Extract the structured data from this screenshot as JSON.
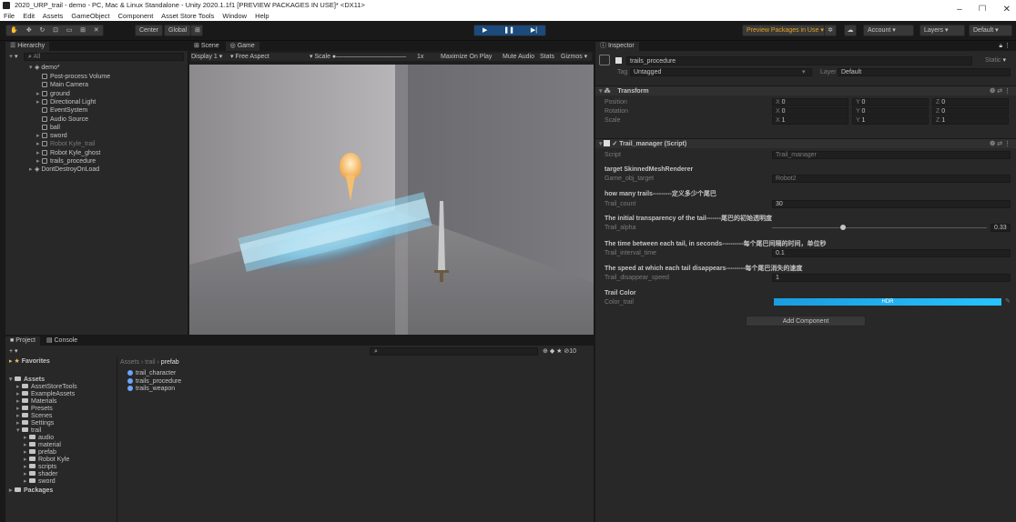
{
  "window": {
    "title": "2020_URP_trail - demo - PC, Mac & Linux Standalone - Unity 2020.1.1f1 [PREVIEW PACKAGES IN USE]* <DX11>",
    "controls": [
      "–",
      "☐",
      "✕"
    ]
  },
  "menu": [
    "File",
    "Edit",
    "Assets",
    "GameObject",
    "Component",
    "Asset Store Tools",
    "Window",
    "Help"
  ],
  "toolbar": {
    "center": "Center",
    "global": "Global",
    "preview": "Preview Packages in Use ▾",
    "account": "Account",
    "layers": "Layers",
    "layout": "Default"
  },
  "hierarchy": {
    "tab": "Hierarchy",
    "search": "All",
    "scene": "demo*",
    "items": [
      {
        "label": "Post-process Volume",
        "dim": false
      },
      {
        "label": "Main Camera",
        "dim": false
      },
      {
        "label": "ground",
        "dim": false
      },
      {
        "label": "Directional Light",
        "dim": false
      },
      {
        "label": "EventSystem",
        "dim": false
      },
      {
        "label": "Audio Source",
        "dim": false
      },
      {
        "label": "ball",
        "dim": false
      },
      {
        "label": "sword",
        "dim": false
      },
      {
        "label": "Robot Kyle_trail",
        "dim": true
      },
      {
        "label": "Robot Kyle_ghost",
        "dim": false
      },
      {
        "label": "trails_procedure",
        "dim": false
      }
    ],
    "dontdestroy": "DontDestroyOnLoad"
  },
  "scene": {
    "tabs": [
      "Scene",
      "Game"
    ],
    "display": "Display 1",
    "aspect": "Free Aspect",
    "scale_label": "Scale",
    "scale_value": "1x",
    "options": [
      "Maximize On Play",
      "Mute Audio",
      "Stats",
      "Gizmos"
    ]
  },
  "project": {
    "tabs": [
      "Project",
      "Console"
    ],
    "favorites": "Favorites",
    "breadcrumb": [
      "Assets",
      "trail",
      "prefab"
    ],
    "hidden_count": "10",
    "tree": [
      {
        "label": "Assets",
        "indent": 0,
        "open": true
      },
      {
        "label": "AssetStoreTools",
        "indent": 1,
        "open": false
      },
      {
        "label": "ExampleAssets",
        "indent": 1,
        "open": false
      },
      {
        "label": "Materials",
        "indent": 1,
        "open": false
      },
      {
        "label": "Presets",
        "indent": 1,
        "open": false
      },
      {
        "label": "Scenes",
        "indent": 1,
        "open": false
      },
      {
        "label": "Settings",
        "indent": 1,
        "open": false
      },
      {
        "label": "trail",
        "indent": 1,
        "open": true
      },
      {
        "label": "audio",
        "indent": 2,
        "open": false
      },
      {
        "label": "material",
        "indent": 2,
        "open": false
      },
      {
        "label": "prefab",
        "indent": 2,
        "open": false
      },
      {
        "label": "Robot Kyle",
        "indent": 2,
        "open": false
      },
      {
        "label": "scripts",
        "indent": 2,
        "open": false
      },
      {
        "label": "shader",
        "indent": 2,
        "open": false
      },
      {
        "label": "sword",
        "indent": 2,
        "open": false
      },
      {
        "label": "Packages",
        "indent": 0,
        "open": false
      }
    ],
    "files": [
      "trail_character",
      "trails_procedure",
      "trails_weapon"
    ]
  },
  "inspector": {
    "tab": "Inspector",
    "object_name": "trails_procedure",
    "static": "Static",
    "tag_label": "Tag",
    "tag": "Untagged",
    "layer_label": "Layer",
    "layer": "Default",
    "transform": {
      "title": "Transform",
      "rows": [
        {
          "label": "Position",
          "x": "0",
          "y": "0",
          "z": "0"
        },
        {
          "label": "Rotation",
          "x": "0",
          "y": "0",
          "z": "0"
        },
        {
          "label": "Scale",
          "x": "1",
          "y": "1",
          "z": "1"
        }
      ]
    },
    "script": {
      "title": "Trail_manager (Script)",
      "script_label": "Script",
      "script_value": "Trail_manager",
      "h1": "target SkinnedMeshRenderer",
      "game_obj_label": "Game_obj_target",
      "game_obj_value": "Robot2",
      "h2": "how many trails---------定义多少个尾巴",
      "count_label": "Trail_count",
      "count_value": "30",
      "h3": "The initial transparency of the tail-------尾巴的初始透明度",
      "alpha_label": "Trail_alpha",
      "alpha_value": "0.33",
      "alpha_fraction": 0.33,
      "h4": "The time between each tail, in seconds----------每个尾巴间隔的时间，单位秒",
      "interval_label": "Trail_interval_time",
      "interval_value": "0.1",
      "h5": "The speed at which each tail disappears---------每个尾巴消失的速度",
      "disappear_label": "Trail_disappear_speed",
      "disappear_value": "1",
      "h6": "Trail Color",
      "color_label": "Color_trail",
      "color_tag": "HDR",
      "color_hex": "#1a9ce0"
    },
    "add_component": "Add Component"
  }
}
